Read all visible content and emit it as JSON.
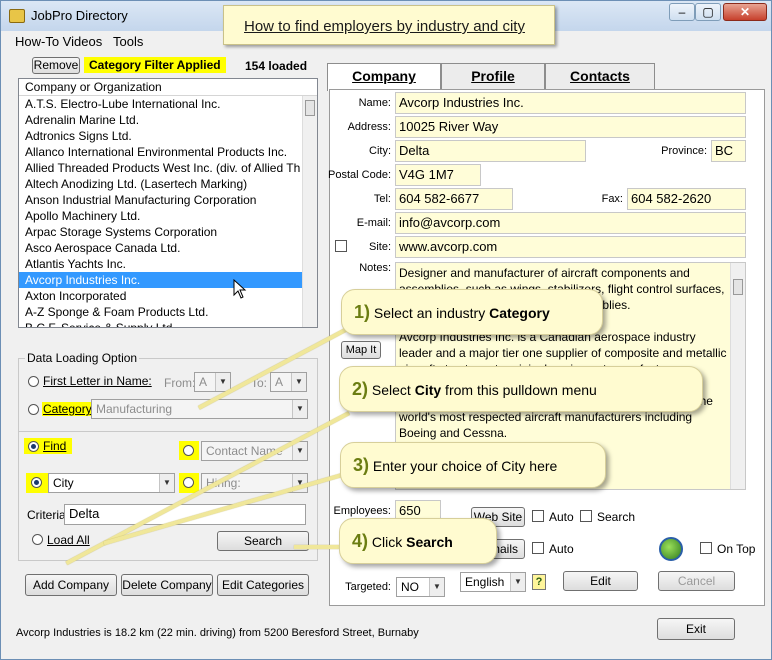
{
  "window": {
    "title": "JobPro Directory",
    "min": "–",
    "max": "▢",
    "close": "✕"
  },
  "banner": "How to find employers by industry and city",
  "menu": [
    "How-To Videos",
    "Tools"
  ],
  "filter": {
    "remove": "Remove",
    "applied": "Category Filter Applied",
    "loaded": "154 loaded"
  },
  "list": {
    "header": "Company or Organization",
    "items": [
      "A.T.S. Electro-Lube International Inc.",
      "Adrenalin Marine Ltd.",
      "Adtronics Signs Ltd.",
      "Allanco International Environmental Products Inc.",
      "Allied Threaded Products West Inc. (div. of Allied Th",
      "Altech Anodizing Ltd. (Lasertech Marking)",
      "Anson Industrial Manufacturing Corporation",
      "Apollo Machinery Ltd.",
      "Arpac Storage Systems Corporation",
      "Asco Aerospace Canada Ltd.",
      "Atlantis Yachts Inc.",
      "Avcorp Industries Inc.",
      "Axton Incorporated",
      "A-Z Sponge & Foam Products Ltd.",
      "B.C.F. Service & Supply Ltd."
    ],
    "selected": 11
  },
  "loading": {
    "group": "Data Loading Option",
    "first_letter": "First Letter in Name:",
    "from": "From:",
    "from_val": "A",
    "to": "To:",
    "to_val": "A",
    "category": "Category:",
    "category_val": "Manufacturing",
    "find": "Find",
    "contact_name": "Contact Name",
    "city": "City",
    "hiring": "Hiring:",
    "criteria": "Criteria:",
    "criteria_val": "Delta",
    "load_all": "Load All",
    "search": "Search"
  },
  "bottom_buttons": [
    "Add Company",
    "Delete Company",
    "Edit Categories"
  ],
  "tabs": [
    "Company",
    "Profile",
    "Contacts"
  ],
  "company": {
    "name_label": "Name:",
    "name": "Avcorp Industries Inc.",
    "address_label": "Address:",
    "address": "10025 River Way",
    "city_label": "City:",
    "city": "Delta",
    "province_label": "Province:",
    "province": "BC",
    "postal_label": "Postal Code:",
    "postal": "V4G 1M7",
    "tel_label": "Tel:",
    "tel": "604 582-6677",
    "fax_label": "Fax:",
    "fax": "604 582-2620",
    "email_label": "E-mail:",
    "email": "info@avcorp.com",
    "site_label": "Site:",
    "site": "www.avcorp.com",
    "notes_label": "Notes:",
    "notes": "Designer and manufacturer of aircraft components and assemblies, such as wings, stabilizers, flight control surfaces, structural components and sub-assemblies.\n\nAvcorp Industries Inc. is a Canadian aerospace industry leader and a major tier one supplier of composite and metallic aircraft structures to original equipment manufacturers.\n\nAvcorp designs and builds major airframe structures for the world's most respected aircraft manufacturers including Boeing and Cessna.",
    "map_it": "Map It",
    "employees_label": "Employees:",
    "employees": "650",
    "web_site": "Web Site",
    "auto": "Auto",
    "search": "Search",
    "emails": "E-mails",
    "on_top": "On Top",
    "targeted_label": "Targeted:",
    "targeted": "NO",
    "language": "English",
    "help": "?",
    "edit": "Edit",
    "cancel": "Cancel"
  },
  "callouts": [
    {
      "num": "1)",
      "pre": "Select an industry ",
      "bold": "Category",
      "post": ""
    },
    {
      "num": "2)",
      "pre": "Select ",
      "bold": "City",
      "post": " from this pulldown menu"
    },
    {
      "num": "3)",
      "pre": "Enter your choice of City here",
      "bold": "",
      "post": ""
    },
    {
      "num": "4)",
      "pre": "Click ",
      "bold": "Search",
      "post": ""
    }
  ],
  "status": "Avcorp Industries is 18.2 km (22 min. driving) from 5200 Beresford Street, Burnaby",
  "exit": "Exit",
  "colors": {
    "field_bg": "#fffdd8",
    "highlight": "#ffff00",
    "selection": "#3399ff",
    "callout": "#fffbd0"
  }
}
